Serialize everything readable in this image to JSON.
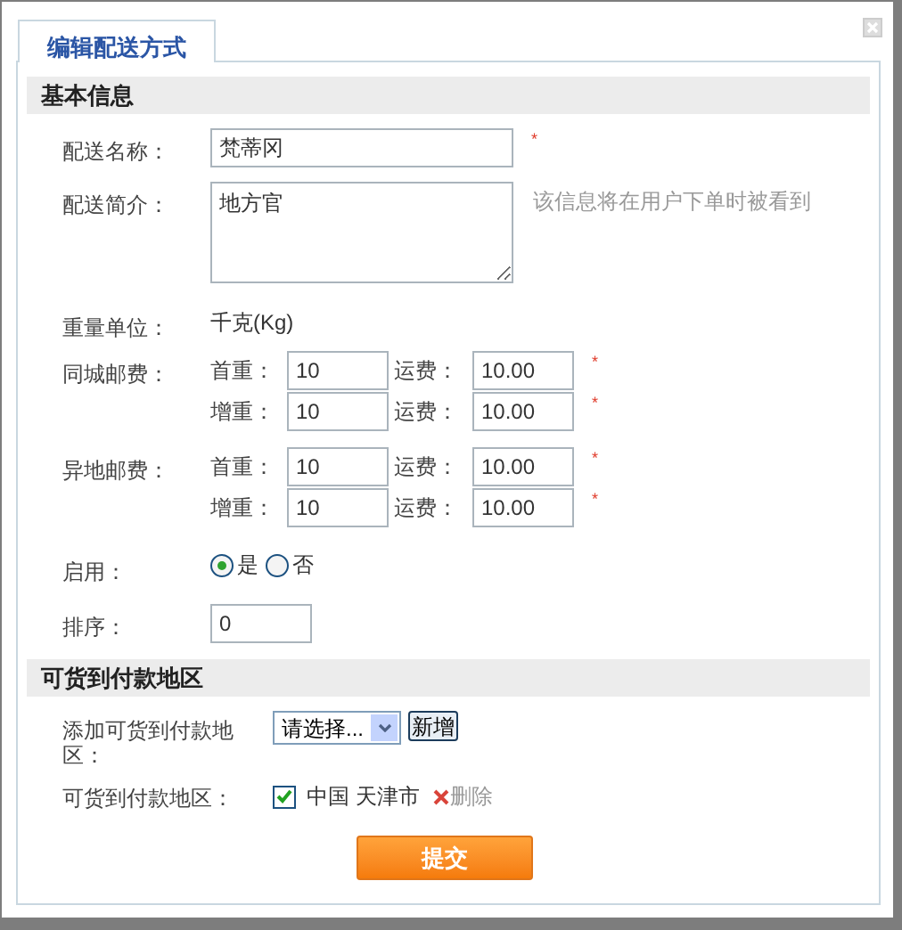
{
  "tab": {
    "label": "编辑配送方式",
    "selected": true
  },
  "basic": {
    "title": "基本信息",
    "name": {
      "label": "配送名称：",
      "value": "梵蒂冈",
      "mark": "*"
    },
    "intro": {
      "label": "配送简介：",
      "value": "地方官",
      "hint": "该信息将在用户下单时被看到"
    },
    "unit": {
      "label": "重量单位：",
      "value": "千克(Kg)"
    },
    "fees": [
      {
        "label": "同城邮费：",
        "rows": [
          {
            "weight_label": "首重：",
            "weight": "10",
            "fee_label": "运费：",
            "fee": "10.00",
            "mark": "*"
          },
          {
            "weight_label": "增重：",
            "weight": "10",
            "fee_label": "运费：",
            "fee": "10.00",
            "mark": "*"
          }
        ]
      },
      {
        "label": "异地邮费：",
        "rows": [
          {
            "weight_label": "首重：",
            "weight": "10",
            "fee_label": "运费：",
            "fee": "10.00",
            "mark": "*"
          },
          {
            "weight_label": "增重：",
            "weight": "10",
            "fee_label": "运费：",
            "fee": "10.00",
            "mark": "*"
          }
        ]
      }
    ],
    "enabled": {
      "label": "启用：",
      "options": [
        {
          "label": "是",
          "selected": true
        },
        {
          "label": "否",
          "selected": false
        }
      ]
    },
    "sort": {
      "label": "排序：",
      "value": "0"
    }
  },
  "cod": {
    "title": "可货到付款地区",
    "add": {
      "label": "添加可货到付款地区：",
      "select": "请选择...",
      "button": "新增"
    },
    "areas": {
      "label": "可货到付款地区：",
      "items": [
        {
          "label": "中国 天津市",
          "checked": true,
          "delete": "删除"
        }
      ]
    }
  },
  "submit": "提交"
}
